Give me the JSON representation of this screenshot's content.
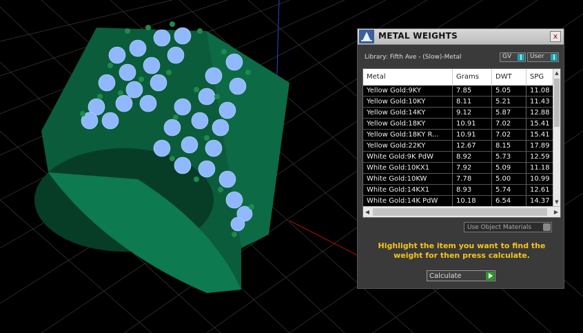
{
  "window": {
    "title": "METAL WEIGHTS",
    "close_label": "x"
  },
  "library": {
    "label": "Library: Fifth Ave - (Slow)-Metal"
  },
  "toggles": {
    "gv_label": "GV",
    "user_label": "User"
  },
  "table": {
    "headers": [
      "Metal",
      "Grams",
      "DWT",
      "SPG"
    ],
    "rows": [
      [
        "Yellow Gold:9KY",
        "7.85",
        "5.05",
        "11.08"
      ],
      [
        "Yellow Gold:10KY",
        "8.11",
        "5.21",
        "11.43"
      ],
      [
        "Yellow Gold:14KY",
        "9.12",
        "5.87",
        "12.88"
      ],
      [
        "Yellow Gold:18KY",
        "10.91",
        "7.02",
        "15.41"
      ],
      [
        "Yellow Gold:18KY R...",
        "10.91",
        "7.02",
        "15.41"
      ],
      [
        "Yellow Gold:22KY",
        "12.67",
        "8.15",
        "17.89"
      ],
      [
        "White Gold:9K PdW",
        "8.92",
        "5.73",
        "12.59"
      ],
      [
        "White Gold:10KX1",
        "7.92",
        "5.09",
        "11.18"
      ],
      [
        "White Gold:10KW",
        "7.78",
        "5.00",
        "10.99"
      ],
      [
        "White Gold:14KX1",
        "8.93",
        "5.74",
        "12.61"
      ],
      [
        "White Gold:14K PdW",
        "10.18",
        "6.54",
        "14.37"
      ]
    ]
  },
  "use_object_materials": {
    "label": "Use Object Materials"
  },
  "hint": {
    "text": "Highlight the item you want to find the weight for then press calculate."
  },
  "calculate": {
    "label": "Calculate"
  },
  "colors": {
    "accent_toggle": "#1aa3b0",
    "hint_text": "#f5c518",
    "model_green": "#0b6b45",
    "gem_blue": "#8fb8ff"
  }
}
